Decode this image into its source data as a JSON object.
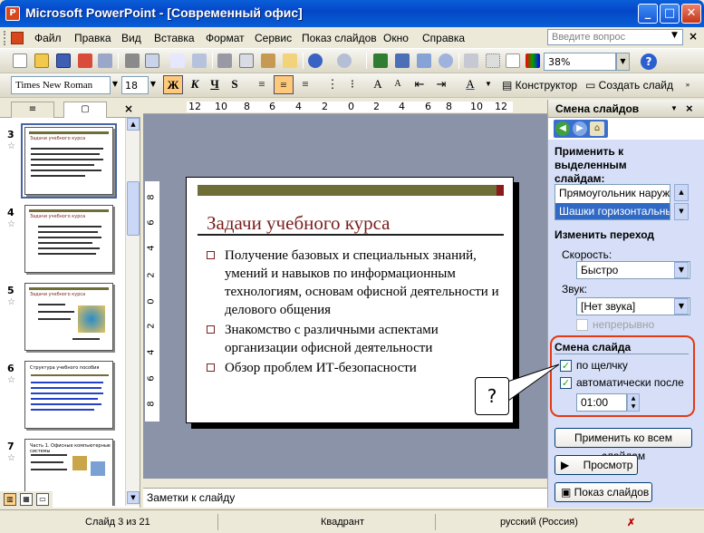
{
  "window": {
    "title": "Microsoft PowerPoint - [Современный офис]",
    "app_icon": "powerpoint-icon",
    "minimize": "_",
    "maximize": "□",
    "close": "✕"
  },
  "menu": {
    "items": [
      "Файл",
      "Правка",
      "Вид",
      "Вставка",
      "Формат",
      "Сервис",
      "Показ слайдов",
      "Окно",
      "Справка"
    ],
    "help_placeholder": "Введите вопрос",
    "close": "×"
  },
  "standard_toolbar": {
    "zoom": "38%",
    "help": "?"
  },
  "formatting_toolbar": {
    "font": "Times New Roman",
    "size": "18",
    "bold": "Ж",
    "italic": "К",
    "underline": "Ч",
    "shadow": "S",
    "design_label": "Конструктор",
    "new_slide_label": "Создать слайд"
  },
  "left_pane": {
    "tab_outline": "≡",
    "tab_slides": "▢",
    "close": "×",
    "slides": [
      {
        "num": "3",
        "title": "Задачи учебного курса",
        "selected": true
      },
      {
        "num": "4",
        "title": "Задачи учебного курса"
      },
      {
        "num": "5",
        "title": "Задачи учебного курса"
      },
      {
        "num": "6",
        "title": "Структура учебного пособия"
      },
      {
        "num": "7",
        "title": "Часть 1. Офисные компьютерные системы"
      }
    ]
  },
  "ruler": {
    "horizontal": [
      "12",
      "10",
      "8",
      "6",
      "4",
      "2",
      "0",
      "2",
      "4",
      "6",
      "8",
      "10",
      "12"
    ],
    "vertical": [
      "8",
      "6",
      "4",
      "2",
      "0",
      "2",
      "4",
      "6",
      "8"
    ]
  },
  "slide": {
    "title": "Задачи учебного курса",
    "bullets": [
      "Получение базовых и специальных знаний, умений и навыков по информационным технологиям, основам офисной деятельности и делового общения",
      "Знакомство с различными аспектами организации офисной деятельности",
      "Обзор проблем ИТ-безопасности"
    ]
  },
  "callout": "?",
  "notes": "Заметки к слайду",
  "task_pane": {
    "title": "Смена слайдов",
    "apply_label": "Применить к выделенным слайдам:",
    "transitions": [
      "Прямоугольник наружу",
      "Шашки горизонтальные"
    ],
    "change_label": "Изменить переход",
    "speed_label": "Скорость:",
    "speed_value": "Быстро",
    "sound_label": "Звук:",
    "sound_value": "[Нет звука]",
    "loop_label": "непрерывно",
    "advance_label": "Смена слайда",
    "on_click_label": "по щелчку",
    "auto_label": "автоматически после",
    "time_value": "01:00",
    "apply_all": "Применить ко всем слайдам",
    "preview": "Просмотр",
    "slideshow": "Показ слайдов"
  },
  "status": {
    "slide": "Слайд 3 из 21",
    "design": "Квадрант",
    "language": "русский (Россия)"
  }
}
